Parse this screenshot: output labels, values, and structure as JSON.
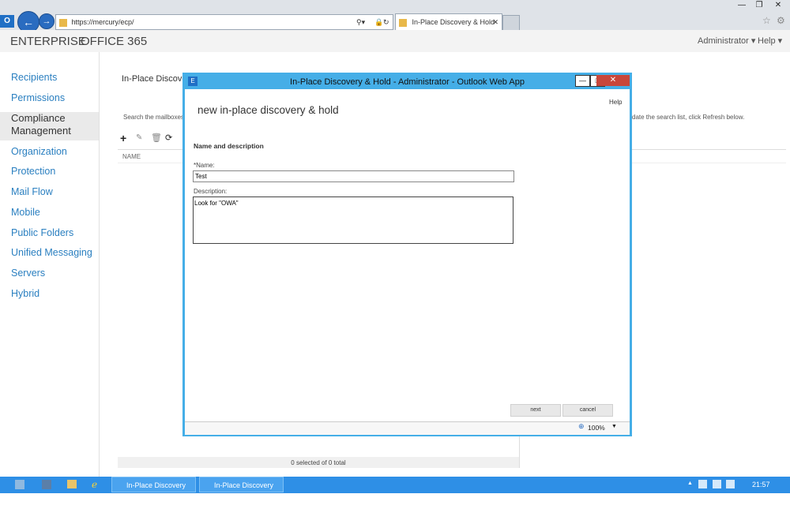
{
  "browser": {
    "url": "https://mercury/ecp/",
    "tab_title": "In-Place Discovery & Hold ...",
    "win_minimize": "—",
    "win_restore": "❐",
    "win_close": "✕"
  },
  "app_header": {
    "brand1": "ENTERPRISE",
    "brand2": "OFFICE 365",
    "user": "Administrator ▾",
    "help": "Help ▾"
  },
  "sidebar": {
    "items": [
      {
        "label": "Recipients"
      },
      {
        "label": "Permissions"
      },
      {
        "label": "Compliance Management"
      },
      {
        "label": "Organization"
      },
      {
        "label": "Protection"
      },
      {
        "label": "Mail Flow"
      },
      {
        "label": "Mobile"
      },
      {
        "label": "Public Folders"
      },
      {
        "label": "Unified Messaging"
      },
      {
        "label": "Servers"
      },
      {
        "label": "Hybrid"
      }
    ]
  },
  "background": {
    "title": "In-Place Discove",
    "instruction_left": "Search the mailboxes",
    "instruction_right": "date the search list, click Refresh below.",
    "column_name": "NAME",
    "status": "0 selected of 0 total"
  },
  "modal": {
    "window_title": "In-Place Discovery & Hold - Administrator - Outlook Web App",
    "heading": "new in-place discovery & hold",
    "help": "Help",
    "section_title": "Name and description",
    "name_label": "*Name:",
    "name_value": "Test",
    "description_label": "Description:",
    "description_value": "Look for \"OWA\"",
    "next_label": "next",
    "cancel_label": "cancel",
    "zoom": "100%"
  },
  "taskbar": {
    "item1": "In-Place Discovery &...",
    "item2": "In-Place Discovery &...",
    "clock": "21:57"
  }
}
